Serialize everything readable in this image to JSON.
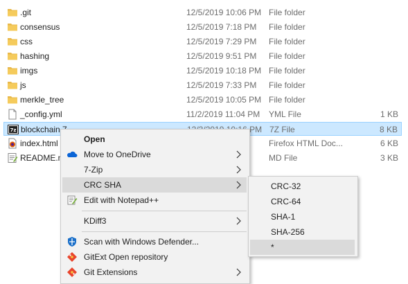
{
  "files": [
    {
      "name": ".git",
      "date": "12/5/2019 10:06 PM",
      "type": "File folder",
      "size": "",
      "icon": "folder-icon"
    },
    {
      "name": "consensus",
      "date": "12/5/2019 7:18 PM",
      "type": "File folder",
      "size": "",
      "icon": "folder-icon"
    },
    {
      "name": "css",
      "date": "12/5/2019 7:29 PM",
      "type": "File folder",
      "size": "",
      "icon": "folder-icon"
    },
    {
      "name": "hashing",
      "date": "12/5/2019 9:51 PM",
      "type": "File folder",
      "size": "",
      "icon": "folder-icon"
    },
    {
      "name": "imgs",
      "date": "12/5/2019 10:18 PM",
      "type": "File folder",
      "size": "",
      "icon": "folder-icon"
    },
    {
      "name": "js",
      "date": "12/5/2019 7:33 PM",
      "type": "File folder",
      "size": "",
      "icon": "folder-icon"
    },
    {
      "name": "merkle_tree",
      "date": "12/5/2019 10:05 PM",
      "type": "File folder",
      "size": "",
      "icon": "folder-icon"
    },
    {
      "name": "_config.yml",
      "date": "11/2/2019 11:04 PM",
      "type": "YML File",
      "size": "1 KB",
      "icon": "document-icon"
    },
    {
      "name": "blockchain.7",
      "date": "12/3/2019 10:16 PM",
      "type": "7Z File",
      "size": "8 KB",
      "icon": "7z-archive-icon"
    },
    {
      "name": "index.html",
      "date": "",
      "type": "Firefox HTML Doc...",
      "size": "6 KB",
      "icon": "html-file-icon"
    },
    {
      "name": "README.m",
      "date": "",
      "type": "MD File",
      "size": "3 KB",
      "icon": "notepadpp-file-icon"
    }
  ],
  "context_menu": {
    "items": [
      {
        "label": "Open",
        "bold": true,
        "icon": "",
        "submenu": false
      },
      {
        "label": "Move to OneDrive",
        "icon": "onedrive-icon",
        "submenu": true
      },
      {
        "label": "7-Zip",
        "icon": "",
        "submenu": true
      },
      {
        "label": "CRC SHA",
        "icon": "",
        "submenu": true,
        "highlighted": true
      },
      {
        "label": "Edit with Notepad++",
        "icon": "notepadpp-icon",
        "submenu": false
      },
      {
        "label": "KDiff3",
        "icon": "",
        "submenu": true
      },
      {
        "label": "Scan with Windows Defender...",
        "icon": "windows-defender-icon",
        "submenu": false
      },
      {
        "label": "GitExt Open repository",
        "icon": "gitext-icon",
        "submenu": false
      },
      {
        "label": "Git Extensions",
        "icon": "git-extensions-icon",
        "submenu": true
      }
    ]
  },
  "submenu": {
    "items": [
      {
        "label": "CRC-32"
      },
      {
        "label": "CRC-64"
      },
      {
        "label": "SHA-1"
      },
      {
        "label": "SHA-256"
      },
      {
        "label": "*",
        "highlighted": true
      }
    ]
  },
  "colors": {
    "selection": "#cce8ff",
    "selection_border": "#99d1ff",
    "menu_bg": "#f2f2f2",
    "menu_highlight": "#dadada",
    "folder": "#e8b84a"
  }
}
